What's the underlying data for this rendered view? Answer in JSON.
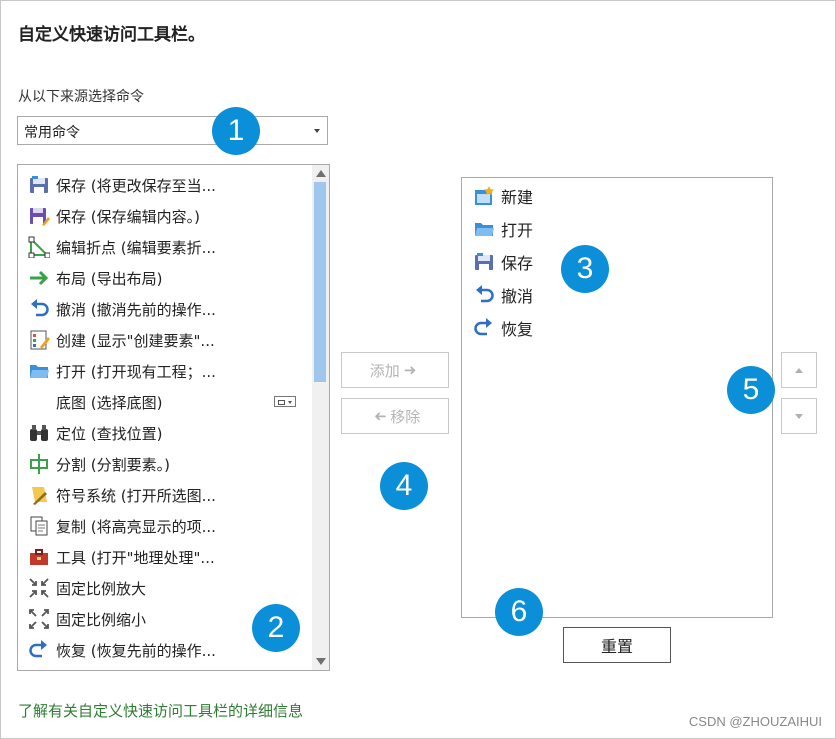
{
  "title": "自定义快速访问工具栏。",
  "source": {
    "label": "从以下来源选择命令",
    "selected": "常用命令"
  },
  "commands": [
    {
      "label": "保存 (将更改保存至当...",
      "icon": "save-icon"
    },
    {
      "label": "保存 (保存编辑内容。)",
      "icon": "save-edits-icon"
    },
    {
      "label": "编辑折点 (编辑要素折...",
      "icon": "edit-vertices-icon"
    },
    {
      "label": "布局 (导出布局)",
      "icon": "arrow-right-icon"
    },
    {
      "label": "撤消 (撤消先前的操作...",
      "icon": "undo-icon"
    },
    {
      "label": "创建 (显示\"创建要素\"...",
      "icon": "create-features-icon"
    },
    {
      "label": "打开 (打开现有工程；...",
      "icon": "open-folder-icon"
    },
    {
      "label": "底图 (选择底图)",
      "icon": ""
    },
    {
      "label": "定位 (查找位置)",
      "icon": "binoculars-icon"
    },
    {
      "label": "分割 (分割要素。)",
      "icon": "split-icon"
    },
    {
      "label": "符号系统 (打开所选图...",
      "icon": "symbology-icon"
    },
    {
      "label": "复制 (将高亮显示的项...",
      "icon": "copy-icon"
    },
    {
      "label": "工具 (打开\"地理处理\"...",
      "icon": "toolbox-icon"
    },
    {
      "label": "固定比例放大",
      "icon": "fixed-zoom-in-icon"
    },
    {
      "label": "固定比例缩小",
      "icon": "fixed-zoom-out-icon"
    },
    {
      "label": "恢复 (恢复先前的操作...",
      "icon": "redo-icon"
    }
  ],
  "buttons": {
    "add": "添加",
    "remove": "移除",
    "reset": "重置"
  },
  "toolbar_items": [
    {
      "label": "新建",
      "icon": "new-project-icon"
    },
    {
      "label": "打开",
      "icon": "open-folder-icon"
    },
    {
      "label": "保存",
      "icon": "save-icon"
    },
    {
      "label": "撤消",
      "icon": "undo-icon"
    },
    {
      "label": "恢复",
      "icon": "redo-icon"
    }
  ],
  "help_link": "了解有关自定义快速访问工具栏的详细信息",
  "badges": [
    "1",
    "2",
    "3",
    "4",
    "5",
    "6"
  ],
  "watermark": "CSDN @ZHOUZAIHUI",
  "colors": {
    "badge": "#0c8fd9",
    "link": "#2e7d32",
    "scroll_thumb": "#9fc7eb"
  }
}
